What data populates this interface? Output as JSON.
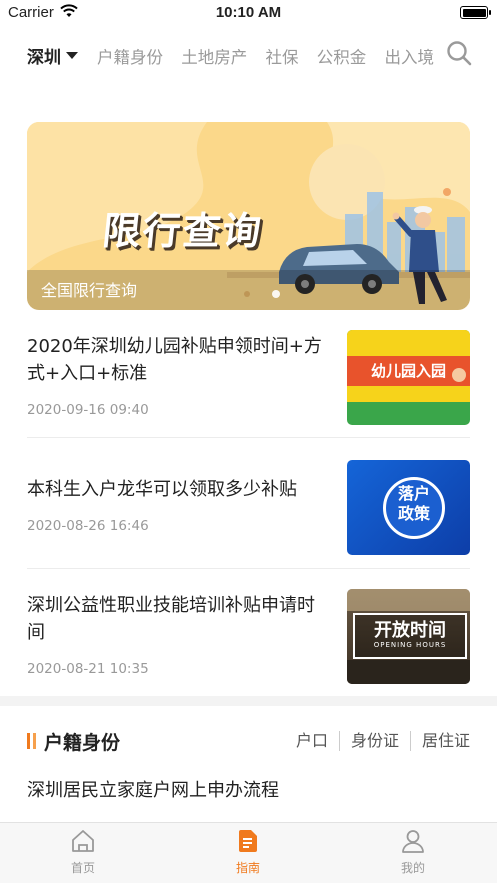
{
  "status_bar": {
    "carrier": "Carrier",
    "time": "10:10 AM"
  },
  "top_nav": {
    "city": "深圳",
    "categories": [
      "户籍身份",
      "土地房产",
      "社保",
      "公积金",
      "出入境"
    ]
  },
  "banner": {
    "headline": "限行查询",
    "caption": "全国限行查询",
    "page_dots": 1
  },
  "news": [
    {
      "title": "2020年深圳幼儿园补贴申领时间+方式+入口+标准",
      "date": "2020-09-16 09:40",
      "thumb_text": "幼儿园入园"
    },
    {
      "title": "本科生入户龙华可以领取多少补贴",
      "date": "2020-08-26 16:46",
      "thumb_text_line1": "落户",
      "thumb_text_line2": "政策"
    },
    {
      "title": "深圳公益性职业技能培训补贴申请时间",
      "date": "2020-08-21 10:35",
      "thumb_text": "开放时间",
      "thumb_sub": "OPENING HOURS"
    }
  ],
  "section": {
    "title": "户籍身份",
    "links": [
      "户口",
      "身份证",
      "居住证"
    ]
  },
  "section_items": [
    {
      "title": "深圳居民立家庭户网上申办流程"
    }
  ],
  "tab_bar": {
    "tabs": [
      {
        "label": "首页",
        "icon": "home-icon"
      },
      {
        "label": "指南",
        "icon": "guide-icon"
      },
      {
        "label": "我的",
        "icon": "user-icon"
      }
    ],
    "active": "指南"
  },
  "colors": {
    "accent": "#f07a1e",
    "banner_bg": "#fbd88a"
  }
}
